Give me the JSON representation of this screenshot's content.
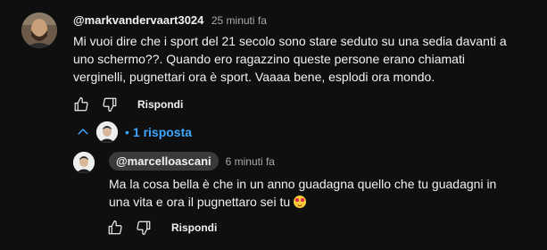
{
  "comment": {
    "author": "@markvandervaart3024",
    "time": "25 minuti fa",
    "text": "Mi vuoi dire che i sport del 21 secolo sono stare seduto su una sedia davanti a uno schermo??. Quando ero ragazzino queste persone erano chiamati verginelli, pugnettari ora è sport. Vaaaa bene, esplodi ora mondo.",
    "reply_label": "Rispondi"
  },
  "replies_toggle": {
    "count_label": "1 risposta"
  },
  "reply": {
    "author": "@marcelloascani",
    "time": "6 minuti fa",
    "text": "Ma la cosa bella è che in un anno guadagna quello che tu guadagni in una vita e ora il pugnettaro sei tu",
    "reply_label": "Rispondi"
  },
  "colors": {
    "background": "#0f0f0f",
    "text": "#f1f1f1",
    "muted": "#aaaaaa",
    "link_blue": "#3ea6ff",
    "chip": "#3a3a3a"
  }
}
